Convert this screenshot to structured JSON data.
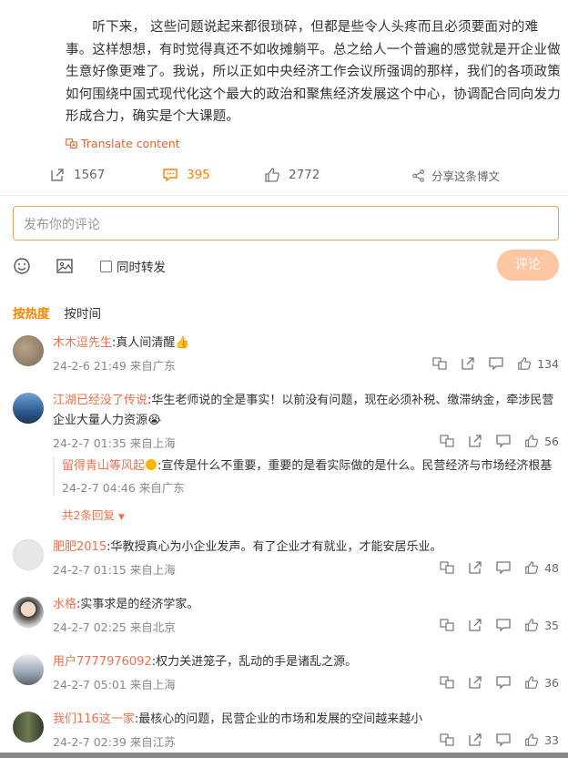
{
  "post": {
    "text": "　　听下来， 这些问题说起来都很琐碎，但都是些令人头疼而且必须要面对的难事。这样想想，有时觉得真还不如收摊躺平。总之给人一个普遍的感觉就是开企业做生意好像更难了。我说，所以正如中央经济工作会议所强调的那样，我们的各项政策如何围绕中国式现代化这个最大的政治和聚焦经济发展这个中心，协调配合同向发力形成合力，确实是个大课题。",
    "translate_label": "Translate content",
    "reposts": "1567",
    "comments": "395",
    "likes": "2772",
    "share_label": "分享这条博文"
  },
  "composer": {
    "placeholder": "发布你的评论",
    "repost_label": "同时转发",
    "submit_label": "评论"
  },
  "sort": {
    "hot": "按热度",
    "time": "按时间"
  },
  "comments": [
    {
      "name": "木木逗先生",
      "text": ":真人间清醒👍",
      "meta": "24-2-6 21:49 来自广东",
      "likes": "134"
    },
    {
      "name": "江湖已经没了传说",
      "text": ":华生老师说的全是事实！以前没有问题，现在必须补税、缴滞纳金，牵涉民营企业大量人力资源😭",
      "meta": "24-2-7 01:35 来自上海",
      "likes": "56"
    },
    {
      "name": "肥肥2015",
      "text": ":华教授真心为小企业发声。有了企业才有就业，才能安居乐业。",
      "meta": "24-2-7 01:15 来自上海",
      "likes": "48"
    },
    {
      "name": "水格",
      "text": ":实事求是的经济学家。",
      "meta": "24-2-7 02:25 来自北京",
      "likes": "35"
    },
    {
      "name": "用户7777976092",
      "text": ":权力关进笼子，乱动的手是诸乱之源。",
      "meta": "24-2-7 05:01 来自上海",
      "likes": "36"
    },
    {
      "name": "我们116这一家",
      "text": ":最核心的问题，民营企业的市场和发展的空间越来越小",
      "meta": "24-2-7 02:39 来自江苏",
      "likes": "33"
    }
  ],
  "reply": {
    "name": "留得青山等风起",
    "text": ":宣传是什么不重要，重要的是看实际做的是什么。民营经济与市场经济根基",
    "meta": "24-2-7 04:46 来自广东",
    "more": "共2条回复"
  },
  "colors": {
    "accent": "#ff8200",
    "name": "#eb7350",
    "submit": "#fcc7a2",
    "input_border": "#f0a15c"
  }
}
